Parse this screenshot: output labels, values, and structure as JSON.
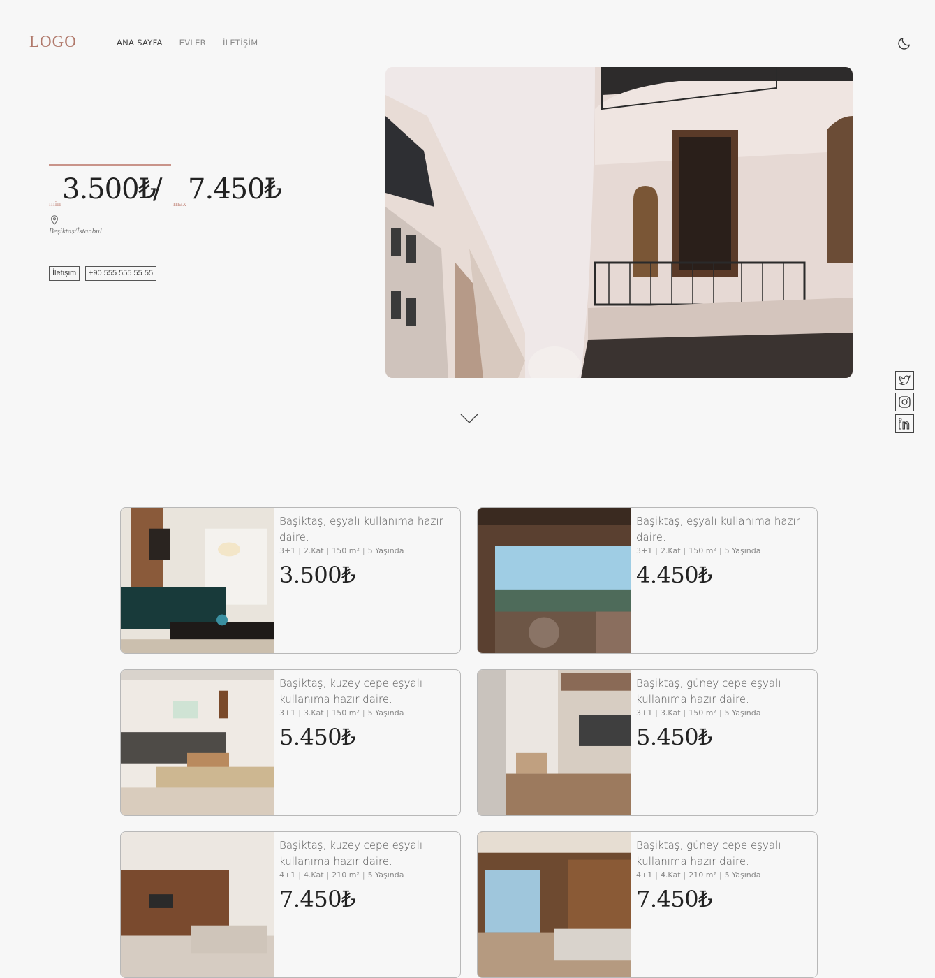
{
  "header": {
    "logo": "LOGO",
    "nav": [
      {
        "label": "ANA SAYFA",
        "active": true
      },
      {
        "label": "EVLER",
        "active": false
      },
      {
        "label": "İLETİŞİM",
        "active": false
      }
    ],
    "theme_toggle_icon": "moon-icon"
  },
  "hero": {
    "price_min": "3.500₺",
    "separator": "/",
    "price_max": "7.450₺",
    "min_label": "min",
    "max_label": "max",
    "location_icon": "map-pin-icon",
    "location": "Beşiktaş/İstanbul",
    "contact_button": "İletişim",
    "phone_button": "+90 555 555 55 55",
    "scroll_icon": "chevron-down-icon"
  },
  "social": [
    "twitter-icon",
    "instagram-icon",
    "linkedin-icon"
  ],
  "listings": [
    {
      "title": "Başiktaş, eşyalı kullanıma hazır daire.",
      "rooms": "3+1",
      "floor": "2.Kat",
      "area": "150 m²",
      "age": "5 Yaşında",
      "price": "3.500₺"
    },
    {
      "title": "Başiktaş, eşyalı kullanıma hazır daire.",
      "rooms": "3+1",
      "floor": "2.Kat",
      "area": "150 m²",
      "age": "5 Yaşında",
      "price": "4.450₺"
    },
    {
      "title": "Başiktaş, kuzey cepe eşyalı kullanıma hazır daire.",
      "rooms": "3+1",
      "floor": "3.Kat",
      "area": "150 m²",
      "age": "5 Yaşında",
      "price": "5.450₺"
    },
    {
      "title": "Başiktaş, güney cepe eşyalı kullanıma hazır daire.",
      "rooms": "3+1",
      "floor": "3.Kat",
      "area": "150 m²",
      "age": "5 Yaşında",
      "price": "5.450₺"
    },
    {
      "title": "Başiktaş, kuzey cepe eşyalı kullanıma hazır daire.",
      "rooms": "4+1",
      "floor": "4.Kat",
      "area": "210 m²",
      "age": "5 Yaşında",
      "price": "7.450₺"
    },
    {
      "title": "Başiktaş, güney cepe eşyalı kullanıma hazır daire.",
      "rooms": "4+1",
      "floor": "4.Kat",
      "area": "210 m²",
      "age": "5 Yaşında",
      "price": "7.450₺"
    }
  ],
  "colors": {
    "accent": "#c9948a",
    "background": "#f7f7f7",
    "text": "#222222"
  }
}
